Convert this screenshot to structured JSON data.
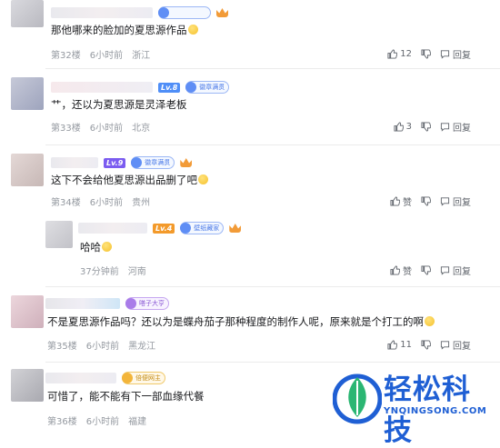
{
  "comments": [
    {
      "text": "那他哪来的脸加的夏思源作品",
      "floor": "第32楼",
      "time": "6小时前",
      "location": "浙江",
      "likes": "12",
      "reply": "回复"
    },
    {
      "level": "Lv.8",
      "medal": "徽章满贯",
      "text": "艹，还以为夏思源是灵泽老板",
      "floor": "第33楼",
      "time": "6小时前",
      "location": "北京",
      "likes": "3",
      "reply": "回复"
    },
    {
      "level": "Lv.9",
      "medal": "徽章满贯",
      "text": "这下不会给他夏思源出品删了吧",
      "floor": "第34楼",
      "time": "6小时前",
      "location": "贵州",
      "likes": "赞",
      "reply": "回复"
    },
    {
      "level": "Lv.4",
      "medal": "壁纸藏家",
      "text": "哈哈",
      "floor": "",
      "time": "37分钟前",
      "location": "河南",
      "likes": "赞",
      "reply": "回复"
    },
    {
      "medal": "嗒子大亨",
      "text": "不是夏思源作品吗？还以为是蝶舟茄子那种程度的制作人呢，原来就是个打工的啊",
      "floor": "第35楼",
      "time": "6小时前",
      "location": "黑龙江",
      "likes": "11",
      "reply": "回复"
    },
    {
      "medal": "倍便网主",
      "text": "可惜了，能不能有下一部血缘代餐",
      "floor": "第36楼",
      "time": "6小时前",
      "location": "福建",
      "likes": "",
      "reply": ""
    }
  ],
  "watermark": {
    "title": "轻松科技",
    "url": "YNQINGSONG.COM"
  },
  "colors": {
    "lv_blue": "#4f8ef7",
    "lv_purple": "#7b5cf0",
    "lv_orange": "#f39a2b",
    "meta_gray": "#9499a0",
    "brand_blue": "#1f5fd4"
  }
}
